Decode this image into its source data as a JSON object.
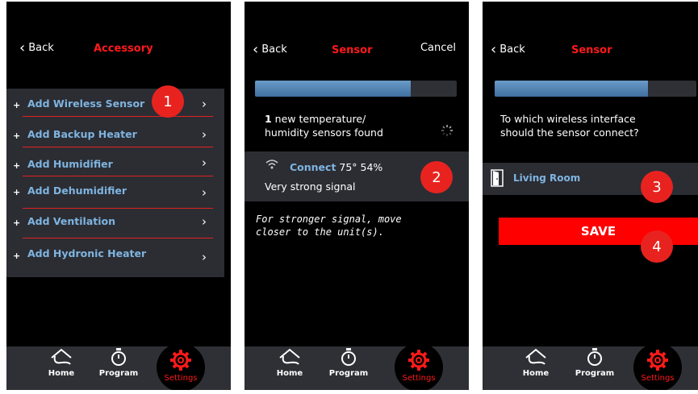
{
  "accessory_screen": {
    "back_label": "Back",
    "title": "Accessory",
    "items": [
      {
        "label": "Add Wireless Sensor"
      },
      {
        "label": "Add Backup Heater"
      },
      {
        "label": "Add Humidifier"
      },
      {
        "label": "Add Dehumidifier"
      },
      {
        "label": "Add Ventilation"
      },
      {
        "label": "Add Hydronic Heater"
      }
    ],
    "plus": "+",
    "badge": "1"
  },
  "sensor_screen": {
    "back_label": "Back",
    "title": "Sensor",
    "cancel_label": "Cancel",
    "progress": 0.77,
    "found_count": "1",
    "found_text_1": " new temperature/",
    "found_text_2": "humidity sensors found",
    "connect_label": "Connect",
    "reading": " 75° 54%",
    "signal_text": "Very strong signal",
    "note": "For stronger signal, move closer to the unit(s).",
    "badge": "2"
  },
  "interface_screen": {
    "back_label": "Back",
    "title": "Sensor",
    "progress": 0.76,
    "question_1": "To which wireless interface",
    "question_2": "should the sensor connect?",
    "room_label": "Living Room",
    "save_label": "SAVE",
    "badge_3": "3",
    "badge_4": "4"
  },
  "nav": {
    "home": "Home",
    "program": "Program",
    "settings": "Settings"
  },
  "colors": {
    "accent_red": "#ff1a1a",
    "link_blue": "#7fb4e0",
    "panel_dark": "#2b2d33"
  }
}
